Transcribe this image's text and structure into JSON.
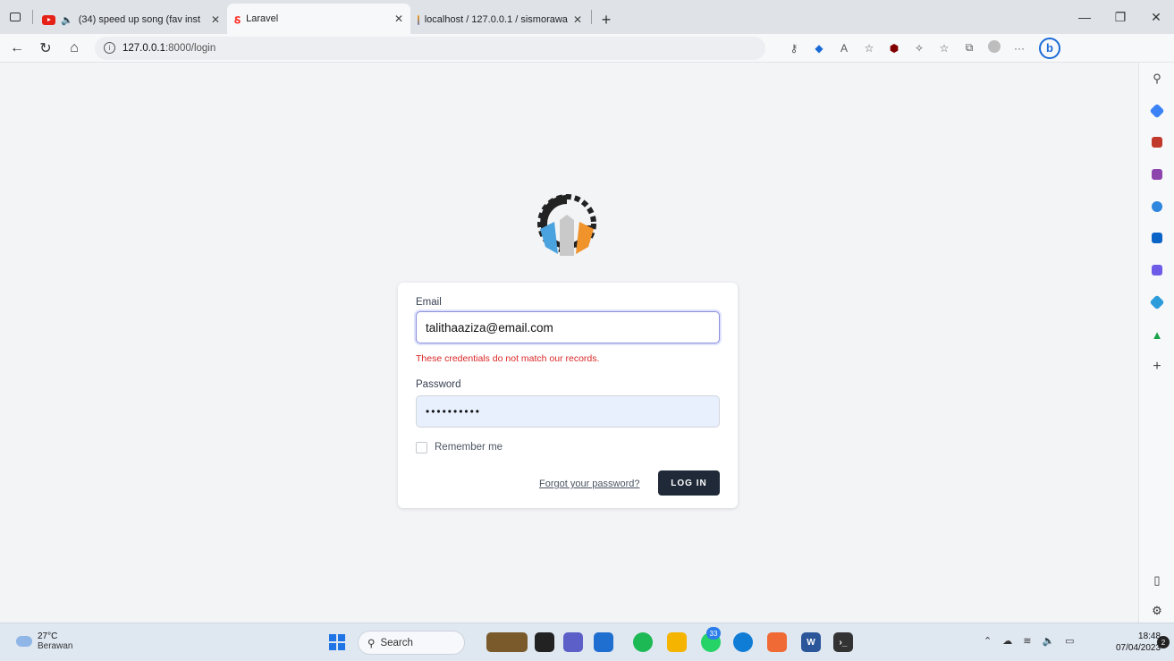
{
  "tabs": [
    {
      "title": "(34) speed up song (fav inst",
      "icon": "youtube-icon"
    },
    {
      "title": "Laravel",
      "icon": "laravel-icon"
    },
    {
      "title": "localhost / 127.0.0.1 / sismorawa",
      "icon": "phpmyadmin-icon"
    }
  ],
  "address": {
    "host": "127.0.0.1",
    "path": ":8000/login"
  },
  "login": {
    "email_label": "Email",
    "email_value": "talithaaziza@email.com",
    "error": "These credentials do not match our records.",
    "password_label": "Password",
    "password_value": "••••••••••",
    "remember_label": "Remember me",
    "forgot_label": "Forgot your password?",
    "submit_label": "LOG IN"
  },
  "taskbar": {
    "temperature": "27°C",
    "weather": "Berawan",
    "search_label": "Search",
    "whatsapp_badge": "33",
    "time": "18:48",
    "date": "07/04/2023",
    "notifications": "2"
  },
  "colors": {
    "primary_button": "#1f2937",
    "error": "#dc2626",
    "focus_border": "#8b8fdc"
  }
}
